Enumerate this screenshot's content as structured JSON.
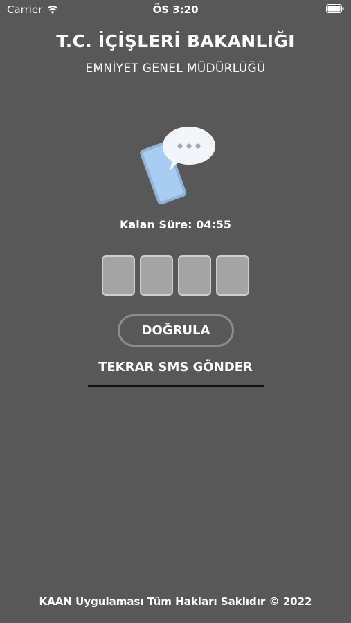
{
  "status_bar": {
    "carrier": "Carrier",
    "time": "ÖS 3:20"
  },
  "header": {
    "title": "T.C. İÇİŞLERİ BAKANLIĞI",
    "subtitle": "EMNİYET GENEL MÜDÜRLÜĞÜ"
  },
  "illustration": {
    "icon": "phone-sms-icon"
  },
  "timer": {
    "text": "Kalan Süre: 04:55"
  },
  "code_inputs": [
    {
      "value": ""
    },
    {
      "value": ""
    },
    {
      "value": ""
    },
    {
      "value": ""
    }
  ],
  "actions": {
    "verify_label": "DOĞRULA",
    "resend_label": "TEKRAR SMS GÖNDER"
  },
  "footer": {
    "text": "KAAN Uygulaması Tüm Hakları Saklıdır © 2022"
  },
  "colors": {
    "background": "#585858",
    "code_box_fill": "#a4a4a4",
    "button_border": "#8c8c8c",
    "underline": "#111111"
  }
}
